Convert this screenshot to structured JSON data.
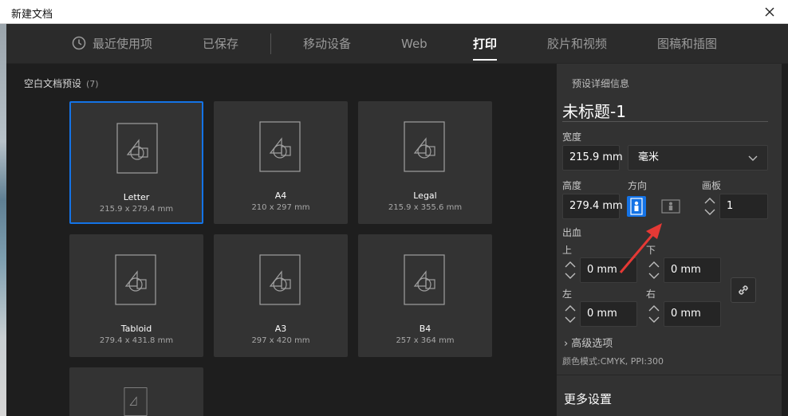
{
  "window": {
    "title": "新建文档"
  },
  "tabs": [
    {
      "label": "最近使用项",
      "icon": "clock-icon"
    },
    {
      "label": "已保存"
    },
    {
      "label": "移动设备"
    },
    {
      "label": "Web"
    },
    {
      "label": "打印",
      "active": true
    },
    {
      "label": "胶片和视频"
    },
    {
      "label": "图稿和插图"
    }
  ],
  "presets": {
    "section_title": "空白文档预设",
    "count": "(7)",
    "cards": [
      {
        "name": "Letter",
        "size": "215.9 x 279.4 mm",
        "selected": true
      },
      {
        "name": "A4",
        "size": "210 x 297 mm"
      },
      {
        "name": "Legal",
        "size": "215.9 x 355.6 mm"
      },
      {
        "name": "Tabloid",
        "size": "279.4 x 431.8 mm"
      },
      {
        "name": "A3",
        "size": "297 x 420 mm"
      },
      {
        "name": "B4",
        "size": "257 x 364 mm"
      },
      {
        "name": "",
        "size": ""
      }
    ]
  },
  "details": {
    "title": "预设详细信息",
    "doc_name": "未标题-1",
    "width_label": "宽度",
    "width_value": "215.9 mm",
    "unit_value": "毫米",
    "height_label": "高度",
    "height_value": "279.4 mm",
    "orientation_label": "方向",
    "artboards_label": "画板",
    "artboards_value": "1",
    "bleed_label": "出血",
    "bleed_top_label": "上",
    "bleed_top_value": "0 mm",
    "bleed_bottom_label": "下",
    "bleed_bottom_value": "0 mm",
    "bleed_left_label": "左",
    "bleed_left_value": "0 mm",
    "bleed_right_label": "右",
    "bleed_right_value": "0 mm",
    "advanced_label": "高级选项",
    "color_mode": "颜色模式:CMYK, PPI:300",
    "more_settings": "更多设置"
  },
  "colors": {
    "accent": "#1473e6",
    "annotation": "#e53935"
  }
}
